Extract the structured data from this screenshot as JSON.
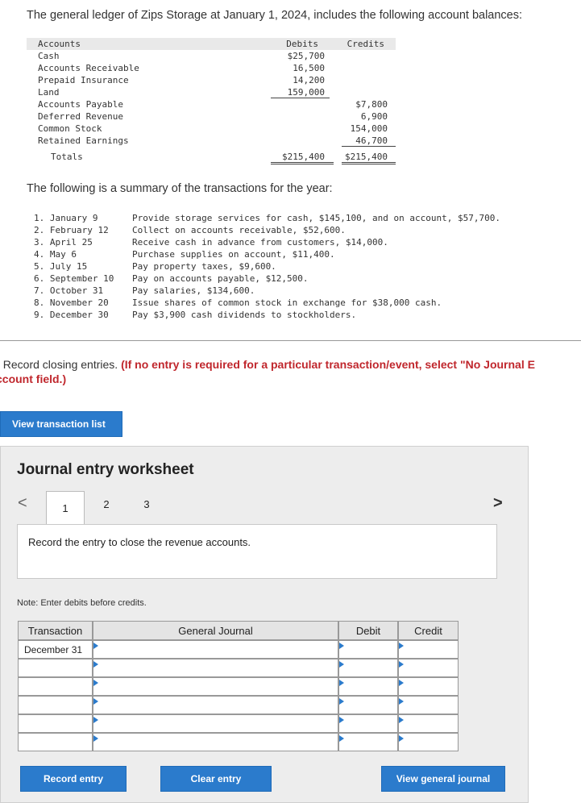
{
  "intro": "The general ledger of Zips Storage at January 1, 2024, includes the following account balances:",
  "ledger": {
    "headers": {
      "accounts": "Accounts",
      "debits": "Debits",
      "credits": "Credits"
    },
    "rows": [
      {
        "account": "Cash",
        "debit": "$25,700",
        "credit": ""
      },
      {
        "account": "Accounts Receivable",
        "debit": "16,500",
        "credit": ""
      },
      {
        "account": "Prepaid Insurance",
        "debit": "14,200",
        "credit": ""
      },
      {
        "account": "Land",
        "debit": "159,000",
        "credit": ""
      },
      {
        "account": "Accounts Payable",
        "debit": "",
        "credit": "$7,800"
      },
      {
        "account": "Deferred Revenue",
        "debit": "",
        "credit": "6,900"
      },
      {
        "account": "Common Stock",
        "debit": "",
        "credit": "154,000"
      },
      {
        "account": "Retained Earnings",
        "debit": "",
        "credit": "46,700"
      }
    ],
    "totals": {
      "label": "Totals",
      "debit": "$215,400",
      "credit": "$215,400"
    }
  },
  "summary_heading": "The following is a summary of the transactions for the year:",
  "transactions": [
    {
      "num": "1. January 9",
      "desc": "Provide storage services for cash, $145,100, and on account, $57,700."
    },
    {
      "num": "2. February 12",
      "desc": "Collect on accounts receivable, $52,600."
    },
    {
      "num": "3. April 25",
      "desc": "Receive cash in advance from customers, $14,000."
    },
    {
      "num": "4. May 6",
      "desc": "Purchase supplies on account, $11,400."
    },
    {
      "num": "5. July 15",
      "desc": "Pay property taxes, $9,600."
    },
    {
      "num": "6. September 10",
      "desc": "Pay on accounts payable, $12,500."
    },
    {
      "num": "7. October 31",
      "desc": "Pay salaries, $134,600."
    },
    {
      "num": "8. November 20",
      "desc": "Issue shares of common stock in exchange for $38,000 cash."
    },
    {
      "num": "9. December 30",
      "desc": "Pay $3,900 cash dividends to stockholders."
    }
  ],
  "instruction": {
    "line1_plain": ". Record closing entries. ",
    "line1_red": "(If no entry is required for a particular transaction/event, select \"No Journal E",
    "line2_red": "ccount field.)"
  },
  "buttons": {
    "view_transaction_list": "View transaction list",
    "record_entry": "Record entry",
    "clear_entry": "Clear entry",
    "view_general_journal": "View general journal"
  },
  "worksheet": {
    "title": "Journal entry worksheet",
    "nav_prev": "<",
    "nav_next": ">",
    "tabs": [
      "1",
      "2",
      "3"
    ],
    "active_tab": "1",
    "entry_prompt": "Record the entry to close the revenue accounts.",
    "note": "Note: Enter debits before credits.",
    "columns": {
      "transaction": "Transaction",
      "general_journal": "General Journal",
      "debit": "Debit",
      "credit": "Credit"
    },
    "rows": [
      {
        "transaction": "December 31",
        "account": "",
        "debit": "",
        "credit": ""
      },
      {
        "transaction": "",
        "account": "",
        "debit": "",
        "credit": ""
      },
      {
        "transaction": "",
        "account": "",
        "debit": "",
        "credit": ""
      },
      {
        "transaction": "",
        "account": "",
        "debit": "",
        "credit": ""
      },
      {
        "transaction": "",
        "account": "",
        "debit": "",
        "credit": ""
      },
      {
        "transaction": "",
        "account": "",
        "debit": "",
        "credit": ""
      }
    ]
  },
  "colors": {
    "accent": "#2b7bcc",
    "instruction_red": "#c0272d",
    "panel_bg": "#ededed"
  }
}
